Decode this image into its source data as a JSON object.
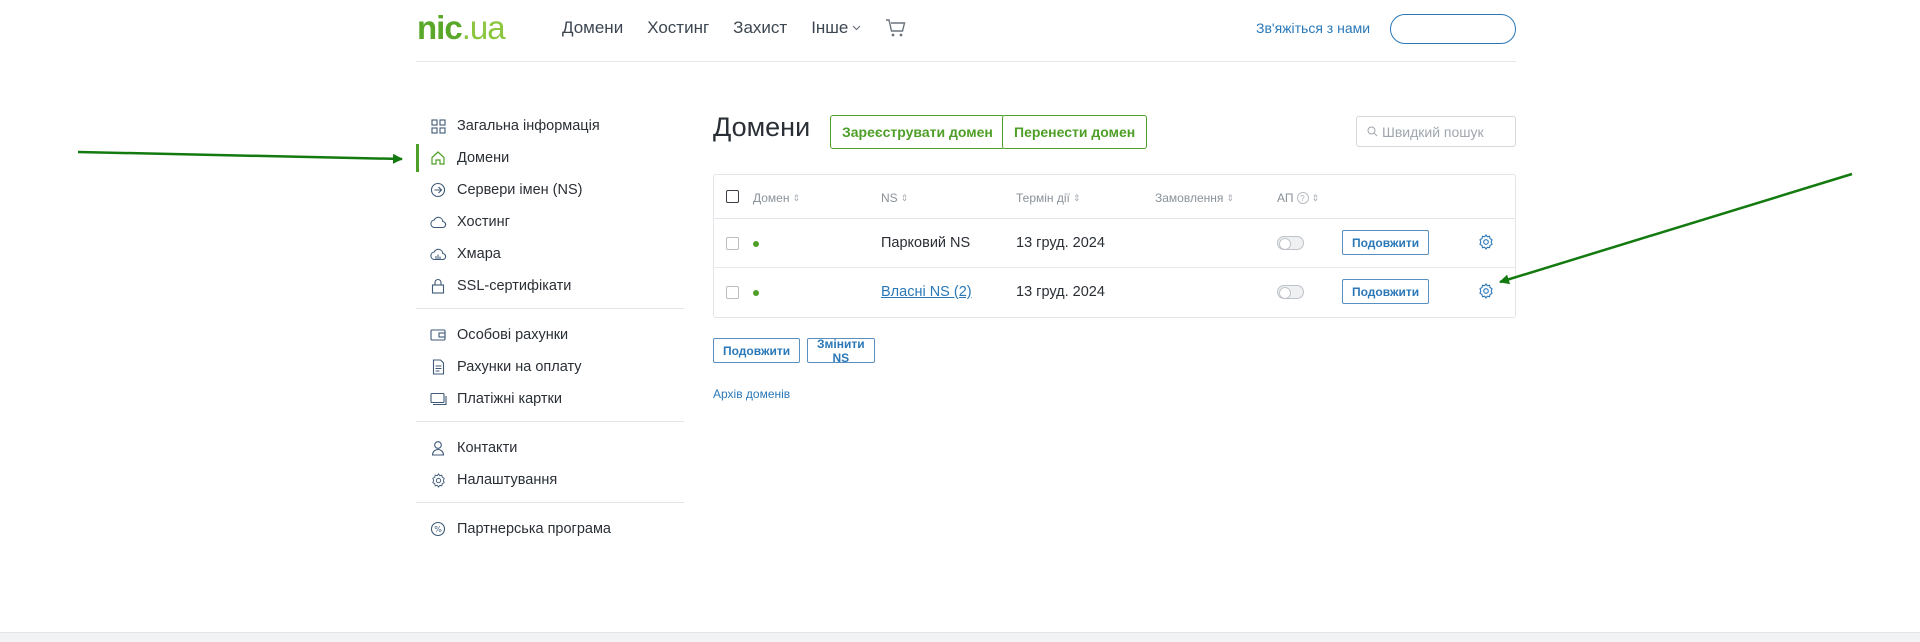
{
  "brand": {
    "logo_part1": "nic",
    "logo_part2": ".ua"
  },
  "header": {
    "nav": [
      "Домени",
      "Хостинг",
      "Захист"
    ],
    "more_label": "Інше",
    "contact": "Зв'яжіться з нами"
  },
  "sidebar": {
    "groups": [
      [
        {
          "label": "Загальна інформація",
          "icon": "grid-icon"
        },
        {
          "label": "Домени",
          "icon": "home-icon",
          "active": true
        },
        {
          "label": "Сервери імен (NS)",
          "icon": "arrow-circle-icon"
        },
        {
          "label": "Хостинг",
          "icon": "cloud-icon"
        },
        {
          "label": "Хмара",
          "icon": "cloud-gauge-icon"
        },
        {
          "label": "SSL-сертифікати",
          "icon": "lock-icon"
        }
      ],
      [
        {
          "label": "Особові рахунки",
          "icon": "wallet-icon"
        },
        {
          "label": "Рахунки на оплату",
          "icon": "document-icon"
        },
        {
          "label": "Платіжні картки",
          "icon": "cards-icon"
        }
      ],
      [
        {
          "label": "Контакти",
          "icon": "user-icon"
        },
        {
          "label": "Налаштування",
          "icon": "gear-icon"
        }
      ],
      [
        {
          "label": "Партнерська програма",
          "icon": "percent-icon"
        }
      ]
    ]
  },
  "main": {
    "title": "Домени",
    "register_btn": "Зареєструвати домен",
    "transfer_btn": "Перенести домен",
    "search_placeholder": "Швидкий пошук",
    "columns": {
      "domain": "Домен",
      "ns": "NS",
      "term": "Термін дії",
      "orders": "Замовлення",
      "ap": "АП"
    },
    "rows": [
      {
        "domain": "",
        "ns": "Парковий NS",
        "ns_link": false,
        "term": "13 груд. 2024",
        "renew": "Подовжити",
        "ap_enabled": false
      },
      {
        "domain": "",
        "ns": "Власні NS (2)",
        "ns_link": true,
        "term": "13 груд. 2024",
        "renew": "Подовжити",
        "ap_enabled": false
      }
    ],
    "bulk_renew": "Подовжити",
    "bulk_change_ns": "Змінити NS",
    "archive_link": "Архів доменів"
  },
  "colors": {
    "accent_green": "#4e9f27",
    "link_blue": "#2a78b8",
    "annotation_green": "#137a0f"
  }
}
